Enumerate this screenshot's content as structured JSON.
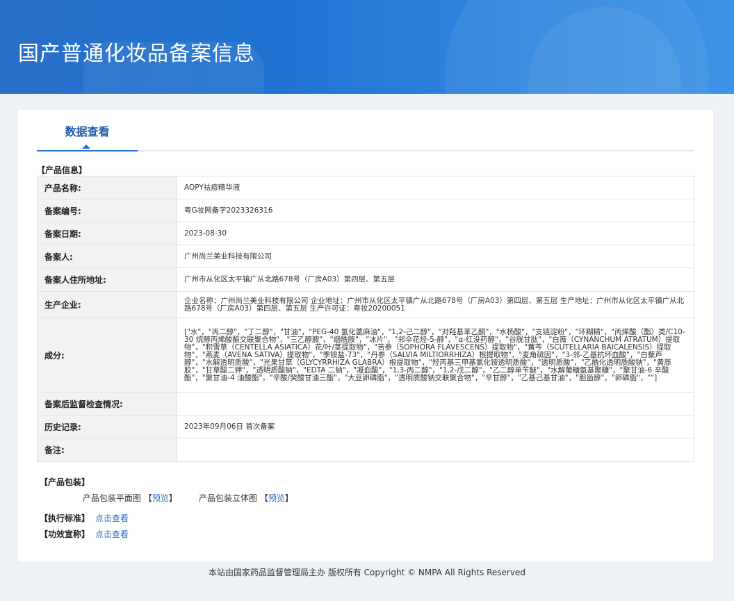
{
  "header": {
    "title": "国产普通化妆品备案信息"
  },
  "tabs": [
    {
      "label": "数据查看"
    }
  ],
  "product_info": {
    "section_label": "【产品信息】",
    "rows": [
      {
        "key": "产品名称:",
        "value": "AOPY祛痘精华液"
      },
      {
        "key": "备案编号:",
        "value": "粤G妆网备字2023326316"
      },
      {
        "key": "备案日期:",
        "value": "2023-08-30"
      },
      {
        "key": "备案人:",
        "value": "广州尚兰美业科技有限公司"
      },
      {
        "key": "备案人住所地址:",
        "value": "广州市从化区太平镇广从北路678号（厂房A03）第四层、第五层"
      },
      {
        "key": "生产企业:",
        "value": "企业名称：广州尚兰美业科技有限公司 企业地址：广州市从化区太平镇广从北路678号（厂房A03）第四层、第五层 生产地址：广州市从化区太平镇广从北路678号（厂房A03）第四层、第五层 生产许可证：粤妆20200051"
      },
      {
        "key": "成分:",
        "value": "[\"水\"，\"丙二醇\"，\"丁二醇\"，\"甘油\"，\"PEG-40 氢化蓖麻油\"，\"1,2-己二醇\"，\"对羟基苯乙酮\"，\"水杨酸\"，\"支链淀粉\"，\"环糊精\"，\"丙烯酸（酯）类/C10-30 烷醇丙烯酸酯交联聚合物\"，\"三乙醇胺\"，\"烟酰胺\"，\"冰片\"，\"邻伞花烃-5-醇\"，\"α-红没药醇\"，\"谷胱甘肽\"，\"白薇（CYNANCHUM ATRATUM）提取物\"，\"积雪草（CENTELLA ASIATICA）花/叶/茎提取物\"，\"苦参（SOPHORA FLAVESCENS）提取物\"，\"黄芩（SCUTELLARIA BAICALENSIS）提取物\"，\"燕麦（AVENA SATIVA）提取物\"，\"季铵盐-73\"，\"丹参（SALVIA MILTIORRHIZA）根提取物\"，\"麦角硫因\"，\"3-邻-乙基抗坏血酸\"，\"白藜芦醇\"，\"水解透明质酸\"，\"光果甘草（GLYCYRRHIZA GLABRA）根提取物\"，\"羟丙基三甲基氯化铵透明质酸\"，\"透明质酸\"，\"乙酰化透明质酸钠\"，\"黄原胶\"，\"甘草酸二钾\"，\"透明质酸钠\"，\"EDTA 二钠\"，\"凝血酸\"，\"1,3-丙二醇\"，\"1,2-戊二醇\"，\"乙二醇单苄醚\"，\"水解葡糖氨基聚糖\"，\"聚甘油-6 辛酸酯\"，\"聚甘油-4 油酸酯\"，\"辛酸/癸酸甘油三酯\"，\"大豆卵磷脂\"，\"透明质酸钠交联聚合物\"，\"辛甘醇\"，\"乙基己基甘油\"，\"胆甾醇\"，\"卵磷脂\"，\"\"]"
      },
      {
        "key": "备案后监督检查情况:",
        "value": ""
      },
      {
        "key": "历史记录:",
        "value": "2023年09月06日 首次备案"
      },
      {
        "key": "备注:",
        "value": ""
      }
    ]
  },
  "packaging": {
    "section_label": "【产品包装】",
    "flat_label": "产品包装平面图",
    "solid_label": "产品包装立体图",
    "bracket_open": "【",
    "bracket_close": "】",
    "preview_label": "预览"
  },
  "standard": {
    "label": "【执行标准】",
    "link": "点击查看"
  },
  "efficacy": {
    "label": "【功效宣称】",
    "link": "点击查看"
  },
  "footer": {
    "text": "本站由国家药品监督管理局主办 版权所有 Copyright © NMPA All Rights Reserved"
  }
}
